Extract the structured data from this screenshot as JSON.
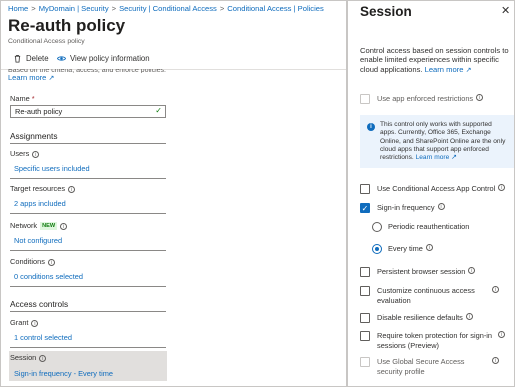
{
  "breadcrumb": [
    "Home",
    "MyDomain | Security",
    "Security | Conditional Access",
    "Conditional Access | Policies"
  ],
  "page": {
    "title": "Re-auth policy",
    "more": "···",
    "subtitle": "Conditional Access policy"
  },
  "toolbar": {
    "delete_label": "Delete",
    "view_info_label": "View policy information"
  },
  "intro": {
    "clipped_text": "Based on the criteria, access, and enforce policies.",
    "learn_more": "Learn more"
  },
  "name_field": {
    "label": "Name",
    "required_mark": "*",
    "value": "Re-auth policy",
    "check": "✓"
  },
  "assignments": {
    "heading": "Assignments",
    "users": {
      "label": "Users",
      "value": "Specific users included"
    },
    "targets": {
      "label": "Target resources",
      "value": "2 apps included"
    },
    "network": {
      "label": "Network",
      "badge": "NEW",
      "value": "Not configured"
    },
    "conditions": {
      "label": "Conditions",
      "value": "0 conditions selected"
    }
  },
  "access_controls": {
    "heading": "Access controls",
    "grant": {
      "label": "Grant",
      "value": "1 control selected"
    },
    "session": {
      "label": "Session",
      "value": "Sign-in frequency - Every time"
    }
  },
  "session_panel": {
    "title": "Session",
    "close": "✕",
    "description": "Control access based on session controls to enable limited experiences within specific cloud applications.",
    "learn_more": "Learn more",
    "app_enforced": "Use app enforced restrictions",
    "info_text": "This control only works with supported apps. Currently, Office 365, Exchange Online, and SharePoint Online are the only cloud apps that support app enforced restrictions.",
    "info_learn_more": "Learn more",
    "casb": "Use Conditional Access App Control",
    "signin_freq": "Sign-in frequency",
    "periodic": "Periodic reauthentication",
    "every_time": "Every time",
    "persistent": "Persistent browser session",
    "continuous": "Customize continuous access evaluation",
    "resilience": "Disable resilience defaults",
    "token_protection": "Require token protection for sign-in sessions (Preview)",
    "gsa": "Use Global Secure Access security profile"
  },
  "colors": {
    "accent": "#0f6cbd",
    "success": "#107c10",
    "info_bg": "#ebf3fc"
  }
}
